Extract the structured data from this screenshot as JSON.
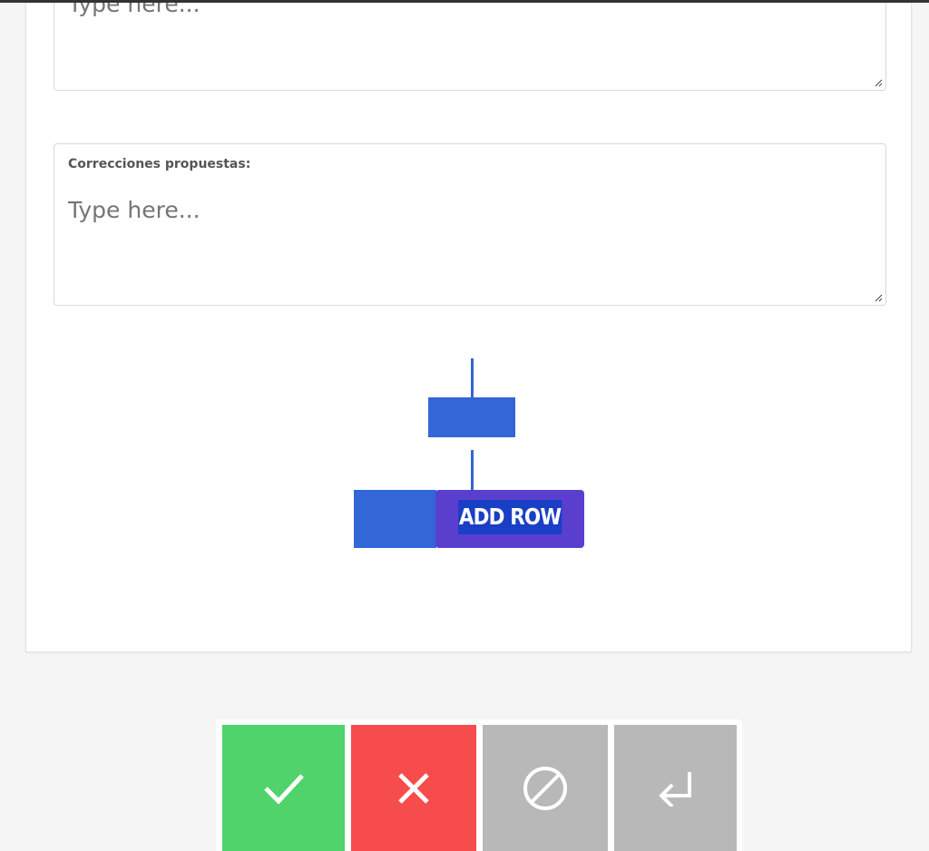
{
  "form": {
    "field1": {
      "placeholder": "Type here..."
    },
    "field2": {
      "label": "Correcciones propuestas:",
      "placeholder": "Type here..."
    }
  },
  "diagram": {
    "add_row_label": "ADD ROW"
  },
  "actions": {
    "accept_icon": "check-icon",
    "reject_icon": "close-icon",
    "skip_icon": "prohibited-icon",
    "back_icon": "return-arrow-icon"
  },
  "colors": {
    "accept": "#4fd36a",
    "reject": "#f74c4c",
    "neutral": "#b8b8b8",
    "diagram_blue": "#3366d6",
    "add_row_purple": "#5a3fcf"
  }
}
